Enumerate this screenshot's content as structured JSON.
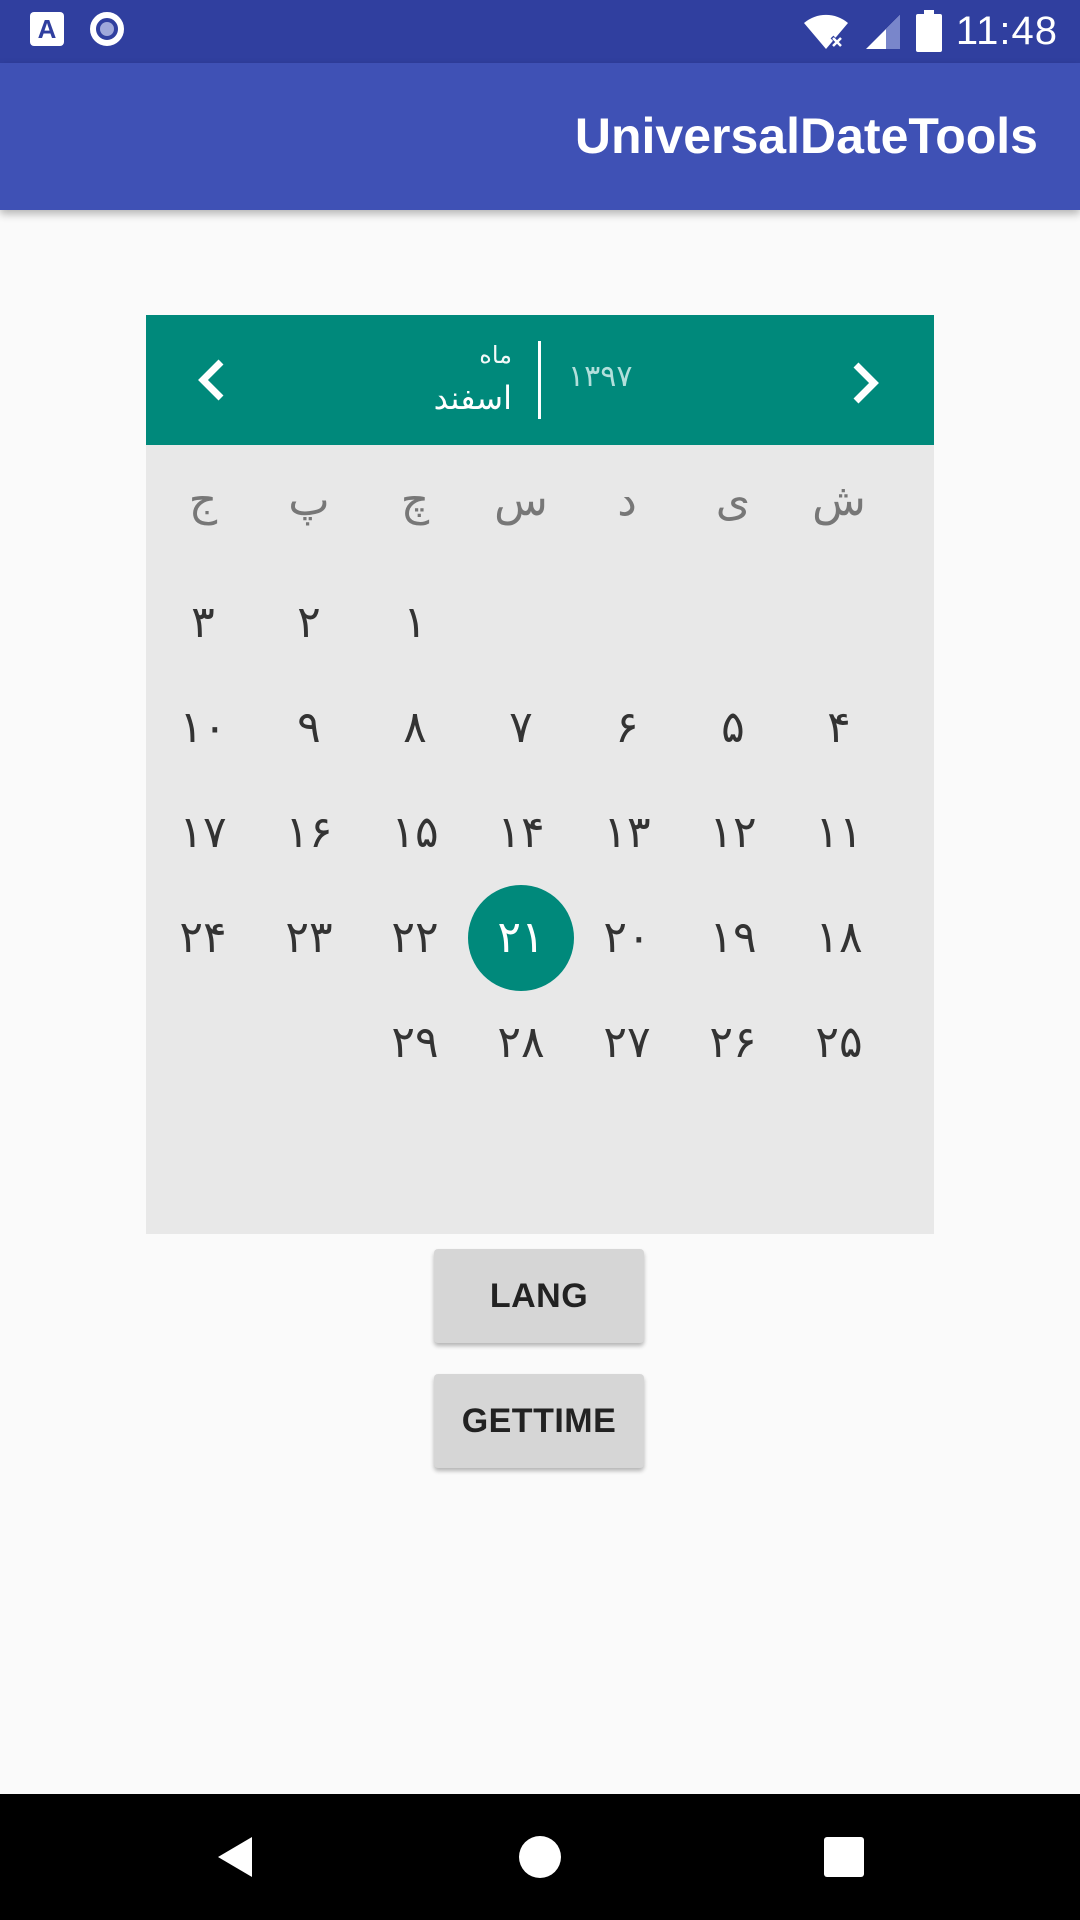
{
  "status_bar": {
    "time": "11:48",
    "app_notification_letter": "A",
    "icons": [
      "app-notification-icon",
      "record-circle-icon",
      "wifi-icon",
      "signal-icon",
      "battery-icon"
    ]
  },
  "app_bar": {
    "title": "UniversalDateTools"
  },
  "calendar": {
    "header": {
      "month_label": "ماه",
      "month_name": "اسفند",
      "year": "۱۳۹۷",
      "prev_icon": "chevron-left-icon",
      "next_icon": "chevron-right-icon"
    },
    "weekdays": [
      "ش",
      "ی",
      "د",
      "س",
      "چ",
      "پ",
      "ج"
    ],
    "weeks": [
      [
        "",
        "",
        "",
        "",
        "۱",
        "۲",
        "۳"
      ],
      [
        "۴",
        "۵",
        "۶",
        "۷",
        "۸",
        "۹",
        "۱۰"
      ],
      [
        "۱۱",
        "۱۲",
        "۱۳",
        "۱۴",
        "۱۵",
        "۱۶",
        "۱۷"
      ],
      [
        "۱۸",
        "۱۹",
        "۲۰",
        "۲۱",
        "۲۲",
        "۲۳",
        "۲۴"
      ],
      [
        "۲۵",
        "۲۶",
        "۲۷",
        "۲۸",
        "۲۹",
        "",
        ""
      ]
    ],
    "selected_day": "۲۱"
  },
  "buttons": {
    "lang": "LANG",
    "gettime": "GETTIME"
  },
  "colors": {
    "status_bar": "#303f9f",
    "app_bar": "#3f51b5",
    "accent_teal": "#00897b",
    "calendar_bg": "#e8e8e8",
    "button_bg": "#d6d6d6"
  },
  "nav_bar": {
    "icons": [
      "back-icon",
      "home-icon",
      "recents-icon"
    ]
  }
}
